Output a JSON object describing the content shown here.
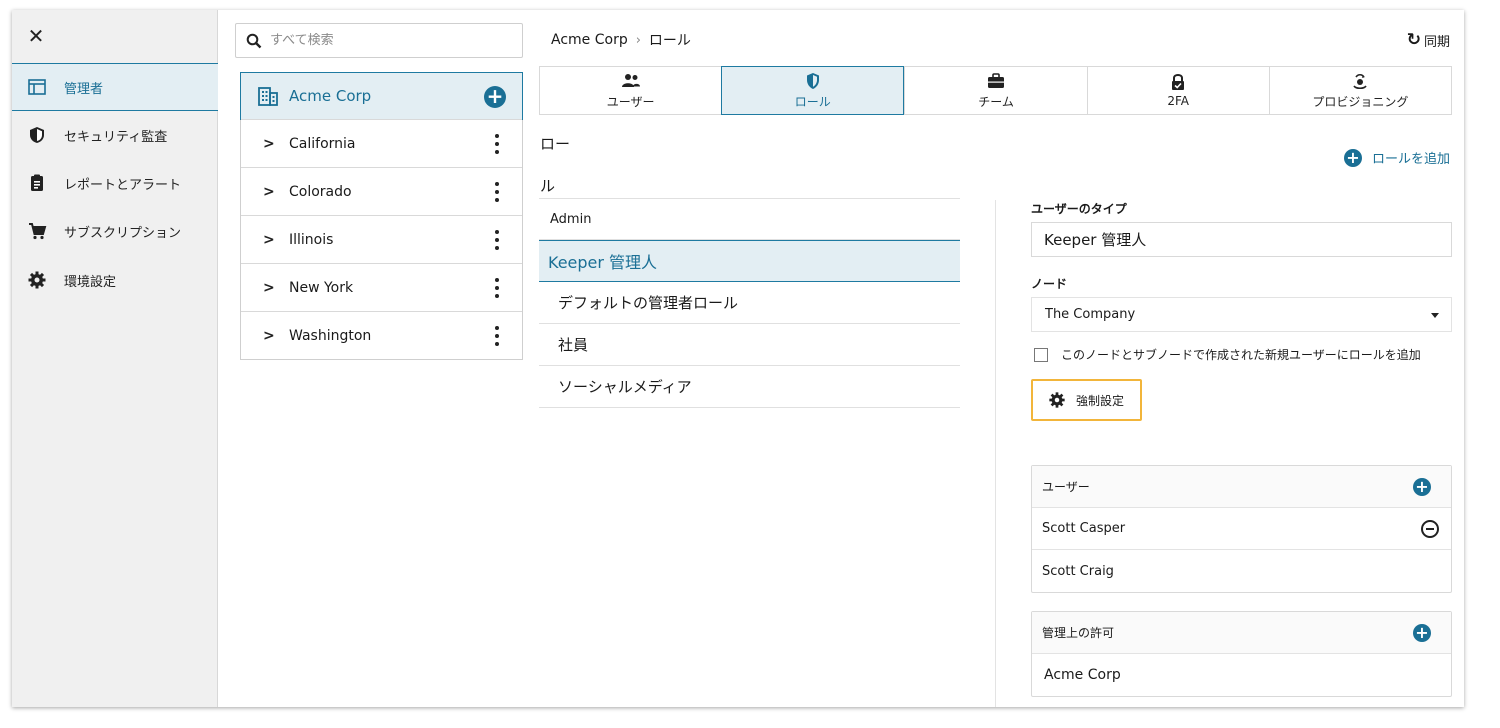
{
  "sidebar": {
    "items": [
      {
        "label": "管理者",
        "icon": "dashboard-icon",
        "active": true
      },
      {
        "label": "セキュリティ監査",
        "icon": "shield-icon"
      },
      {
        "label": "レポートとアラート",
        "icon": "clipboard-icon"
      },
      {
        "label": "サブスクリプション",
        "icon": "cart-icon"
      },
      {
        "label": "環境設定",
        "icon": "gear-icon"
      }
    ]
  },
  "search": {
    "placeholder": "すべて検索"
  },
  "tree": {
    "root": "Acme Corp",
    "nodes": [
      "California",
      "Colorado",
      "Illinois",
      "New York",
      "Washington"
    ]
  },
  "breadcrumb": {
    "root": "Acme Corp",
    "current": "ロール"
  },
  "sync_label": "同期",
  "tabs": [
    {
      "label": "ユーザー",
      "icon": "users-icon"
    },
    {
      "label": "ロール",
      "icon": "shield-icon",
      "active": true
    },
    {
      "label": "チーム",
      "icon": "briefcase-icon"
    },
    {
      "label": "2FA",
      "icon": "lock-icon"
    },
    {
      "label": "プロビジョニング",
      "icon": "provisioning-icon"
    }
  ],
  "roles": {
    "heading": "ロール",
    "add_label": "ロールを追加",
    "group": "Admin",
    "items": [
      "Keeper 管理人",
      "デフォルトの管理者ロール",
      "社員",
      "ソーシャルメディア"
    ],
    "selected": "Keeper 管理人"
  },
  "detail": {
    "user_type_label": "ユーザーのタイプ",
    "user_type_value": "Keeper 管理人",
    "node_label": "ノード",
    "node_value": "The Company",
    "auto_add_label": "このノードとサブノードで作成された新規ユーザーにロールを追加",
    "auto_add_checked": false,
    "enforce_label": "強制設定",
    "users_header": "ユーザー",
    "users": [
      "Scott Casper",
      "Scott Craig"
    ],
    "perms_header": "管理上の許可",
    "perms": [
      "Acme Corp"
    ]
  },
  "colors": {
    "accent": "#1a6f95",
    "active_bg": "#e3eef3",
    "enforce_border": "#f2b53a"
  }
}
